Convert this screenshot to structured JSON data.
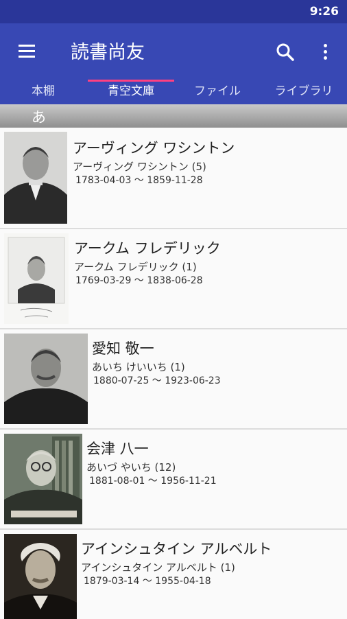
{
  "status_bar": {
    "time": "9:26"
  },
  "app_bar": {
    "title": "読書尚友"
  },
  "tabs": [
    {
      "label": "本棚"
    },
    {
      "label": "青空文庫"
    },
    {
      "label": "ファイル"
    },
    {
      "label": "ライブラリ"
    }
  ],
  "active_tab": "青空文庫",
  "section": {
    "letter": "あ"
  },
  "authors": [
    {
      "name": "アーヴィング ワシントン",
      "reading": "アーヴィング ワシントン (5)",
      "dates": "1783-04-03 ～ 1859-11-28"
    },
    {
      "name": "アークム フレデリック",
      "reading": "アークム フレデリック (1)",
      "dates": "1769-03-29 ～ 1838-06-28"
    },
    {
      "name": "愛知 敬一",
      "reading": "あいち けいいち (1)",
      "dates": "1880-07-25 ～ 1923-06-23"
    },
    {
      "name": "会津 八一",
      "reading": "あいづ やいち (12)",
      "dates": "1881-08-01 ～ 1956-11-21"
    },
    {
      "name": "アインシュタイン アルベルト",
      "reading": "アインシュタイン アルベルト (1)",
      "dates": "1879-03-14 ～ 1955-04-18"
    }
  ],
  "colors": {
    "status_bar": "#2a3699",
    "app_bar": "#3848b4",
    "tab_indicator": "#ff4081"
  }
}
